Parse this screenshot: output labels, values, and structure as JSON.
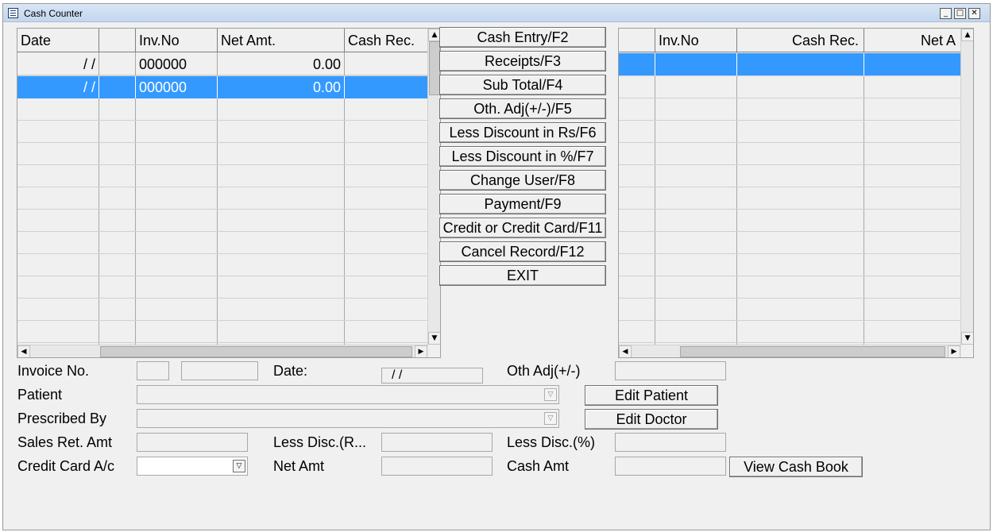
{
  "window": {
    "title": "Cash Counter"
  },
  "left_grid": {
    "columns": [
      "Date",
      "",
      "Inv.No",
      "Net Amt.",
      "Cash Rec."
    ],
    "rows": [
      {
        "date": "/  /",
        "inv_no": "000000",
        "net_amt": "0.00",
        "cash_rec": ""
      },
      {
        "date": "/  /",
        "inv_no": "000000",
        "net_amt": "0.00",
        "cash_rec": ""
      }
    ]
  },
  "right_grid": {
    "columns": [
      "",
      "Inv.No",
      "Cash Rec.",
      "Net A"
    ]
  },
  "actions": {
    "cash_entry": "Cash Entry/F2",
    "receipts": "Receipts/F3",
    "sub_total": "Sub Total/F4",
    "oth_adj": "Oth. Adj(+/-)/F5",
    "less_disc_rs": "Less Discount in Rs/F6",
    "less_disc_pct": "Less Discount in %/F7",
    "change_user": "Change User/F8",
    "payment": "Payment/F9",
    "credit_card": "Credit or Credit Card/F11",
    "cancel_record": "Cancel Record/F12",
    "exit": "EXIT"
  },
  "form": {
    "invoice_no_label": "Invoice No.",
    "date_label": "Date:",
    "date_value": "/  /",
    "oth_adj_label": "Oth Adj(+/-)",
    "patient_label": "Patient",
    "edit_patient": "Edit Patient",
    "prescribed_by_label": "Prescribed By",
    "edit_doctor": "Edit Doctor",
    "sales_ret_label": "Sales Ret. Amt",
    "less_disc_r_label": "Less Disc.(R...",
    "less_disc_pct_label": "Less Disc.(%)",
    "credit_card_ac_label": "Credit Card A/c",
    "net_amt_label": "Net Amt",
    "cash_amt_label": "Cash Amt",
    "view_cash_book": "View Cash Book"
  }
}
